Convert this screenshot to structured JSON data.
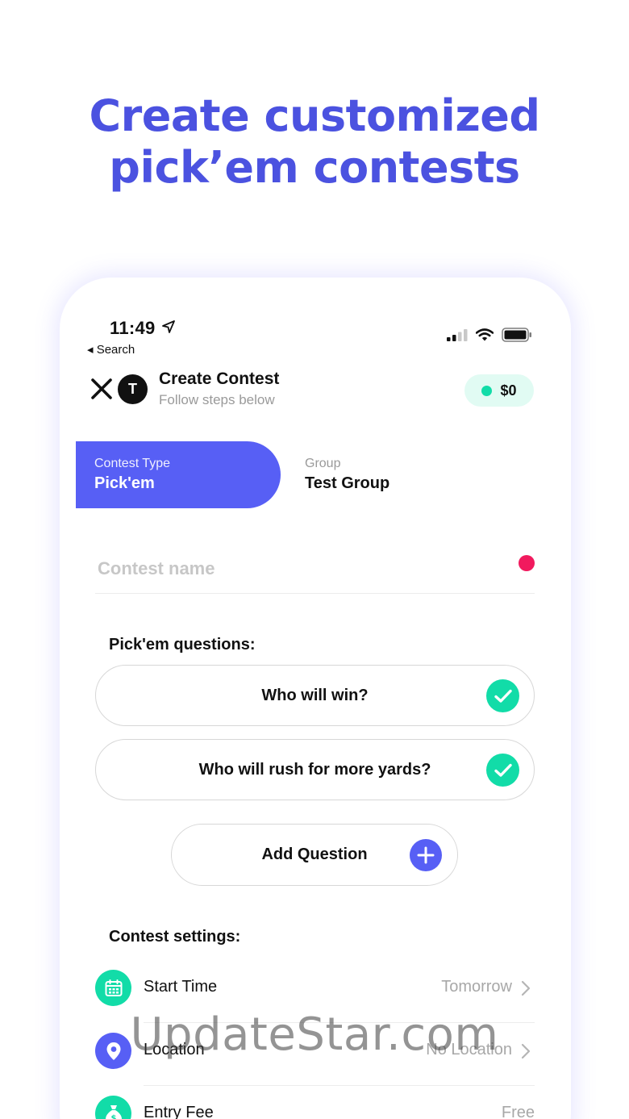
{
  "headline": {
    "line1": "Create customized",
    "line2": "pick’em contests"
  },
  "status_bar": {
    "time": "11:49",
    "back_label": "◂ Search"
  },
  "header": {
    "avatar_letter": "T",
    "title": "Create Contest",
    "subtitle": "Follow steps below",
    "balance": "$0"
  },
  "tabs": {
    "contest_type": {
      "label": "Contest Type",
      "value": "Pick'em"
    },
    "group": {
      "label": "Group",
      "value": "Test Group"
    }
  },
  "contest_name": {
    "placeholder": "Contest name",
    "value": ""
  },
  "questions": {
    "heading": "Pick'em questions:",
    "items": [
      "Who will win?",
      "Who will rush for more yards?"
    ],
    "add_label": "Add Question"
  },
  "settings": {
    "heading": "Contest settings:",
    "items": [
      {
        "label": "Start Time",
        "value": "Tomorrow",
        "icon": "calendar-icon",
        "color": "#12dca8"
      },
      {
        "label": "Location",
        "value": "No Location",
        "icon": "location-pin-icon",
        "color": "#575ff5"
      },
      {
        "label": "Entry Fee",
        "value": "Free",
        "icon": "money-bag-icon",
        "color": "#12dca8"
      }
    ]
  },
  "colors": {
    "brand": "#4b52e0",
    "accent": "#575ff5",
    "success": "#12dca8",
    "alert": "#f11a5e"
  },
  "watermark": "UpdateStar.com"
}
